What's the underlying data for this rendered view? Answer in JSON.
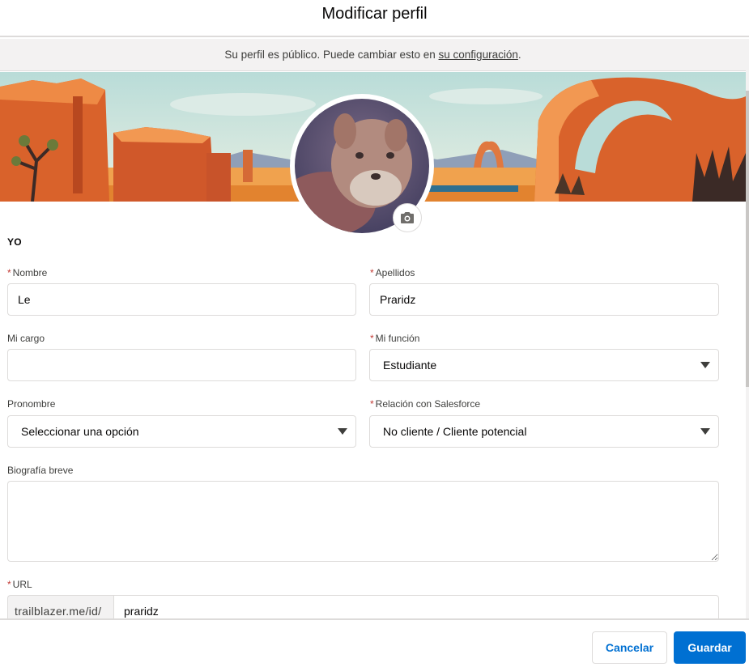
{
  "header": {
    "title": "Modificar perfil"
  },
  "notice": {
    "text_before": "Su perfil es público. Puede cambiar esto en ",
    "link": "su configuración",
    "text_after": "."
  },
  "section": {
    "title": "YO"
  },
  "fields": {
    "nombre": {
      "label": "Nombre",
      "required_mark": "*",
      "value": "Le"
    },
    "apellidos": {
      "label": "Apellidos",
      "required_mark": "*",
      "value": "Praridz"
    },
    "mi_cargo": {
      "label": "Mi cargo",
      "value": ""
    },
    "mi_funcion": {
      "label": "Mi función",
      "required_mark": "*",
      "value": "Estudiante"
    },
    "pronombre": {
      "label": "Pronombre",
      "value": "Seleccionar una opción"
    },
    "relacion": {
      "label": "Relación con Salesforce",
      "required_mark": "*",
      "value": "No cliente / Cliente potencial"
    },
    "biografia": {
      "label": "Biografía breve",
      "value": ""
    },
    "url": {
      "label": "URL",
      "required_mark": "*",
      "prefix": "trailblazer.me/id/",
      "value": "praridz"
    }
  },
  "footer": {
    "cancel_label": "Cancelar",
    "save_label": "Guardar"
  },
  "colors": {
    "brand": "#0070d2",
    "required": "#c23934",
    "border": "#dddbda"
  },
  "icons": {
    "camera": "camera-icon",
    "dropdown": "chevron-down-icon"
  }
}
